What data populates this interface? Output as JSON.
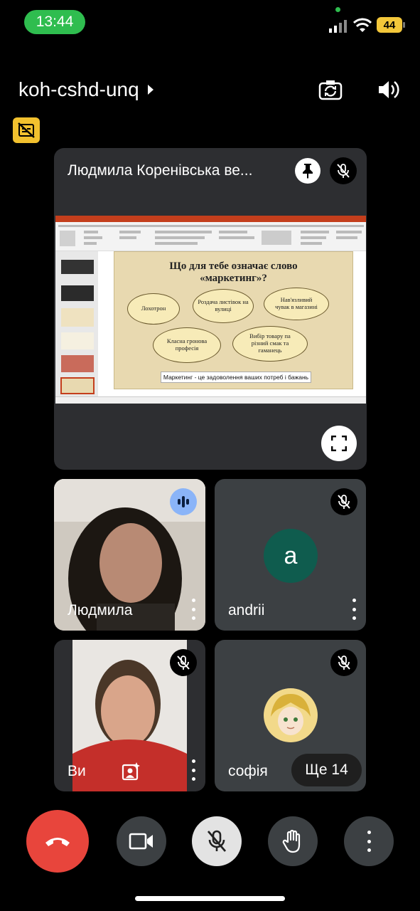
{
  "status_bar": {
    "time": "13:44",
    "battery": "44"
  },
  "header": {
    "meeting_code": "koh-cshd-unq"
  },
  "presentation_tile": {
    "title": "Людмила Коренівська ве...",
    "slide": {
      "title_line1": "Що для тебе означає слово",
      "title_line2": "«маркетинг»?",
      "ovals": [
        "Лохотрон",
        "Роздача листівок на вулиці",
        "Нав'язливий чувак в магазині",
        "Класна гронова професія",
        "Вибір товару па різний смак та гаманець"
      ],
      "footer": "Маркетинг - це задоволення ваших потреб і бажань"
    }
  },
  "participants": [
    {
      "name": "Людмила",
      "speaking": true
    },
    {
      "name": "andrii",
      "initial": "a",
      "avatar_color": "#0f5c4e",
      "muted": true
    },
    {
      "name": "Ви",
      "muted": true
    },
    {
      "name": "софія",
      "muted": true
    }
  ],
  "more_participants": "Ще 14",
  "colors": {
    "end_call": "#e8453c",
    "status_green": "#2fbd4f",
    "battery": "#f3c73a",
    "speaking_badge": "#8ab4f8"
  }
}
